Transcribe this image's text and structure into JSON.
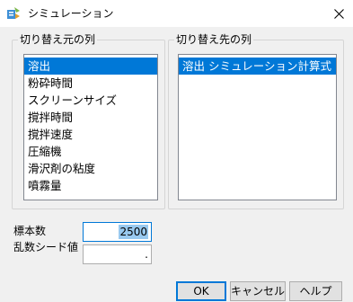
{
  "window": {
    "title": "シミュレーション",
    "icon": "simulation-app-icon",
    "close_icon": "close-icon"
  },
  "source_columns": {
    "label": "切り替え元の列",
    "items": [
      "溶出",
      "粉砕時間",
      "スクリーンサイズ",
      "撹拌時間",
      "撹拌速度",
      "圧縮機",
      "滑沢剤の粘度",
      "噴霧量"
    ],
    "selected_index": 0
  },
  "target_columns": {
    "label": "切り替え先の列",
    "items": [
      "溶出 シミュレーション計算式"
    ],
    "selected_index": 0
  },
  "sample_size": {
    "label": "標本数",
    "value": "2500"
  },
  "random_seed": {
    "label": "乱数シード値",
    "value": "."
  },
  "buttons": {
    "ok": "OK",
    "cancel": "キャンセル",
    "help": "ヘルプ"
  },
  "colors": {
    "selection": "#0078d7",
    "dialog_bg": "#f0f0f0"
  }
}
